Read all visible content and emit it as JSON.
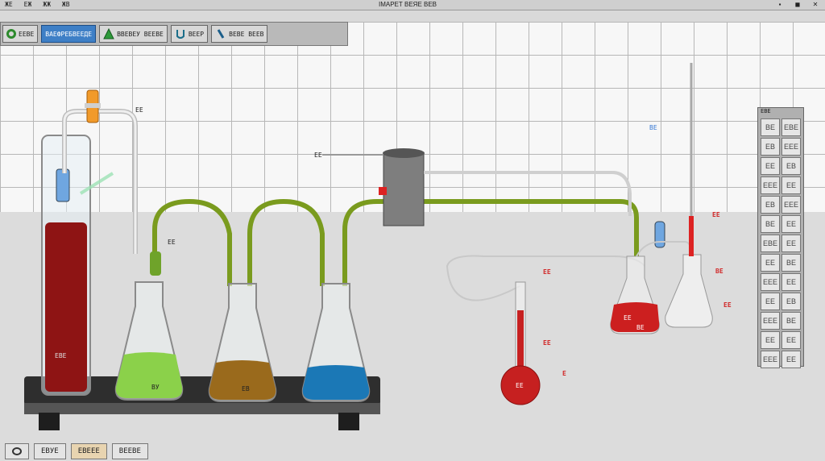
{
  "window": {
    "title": "ІМАРЕТ ВЕЯЕ ВЕВ"
  },
  "menu": [
    "ЖЕ",
    "ЕЖ",
    "ЖЖ",
    "ЖВ"
  ],
  "toolbar": {
    "items": [
      {
        "label": "ЕЕВЕ",
        "icon": "green-ring-icon"
      },
      {
        "label": "ВАЕФРЕБВЕЕДЕ",
        "icon": ""
      },
      {
        "label": "ВВЕВЕУ ВЕЕВЕ",
        "icon": "triangle-flask-icon"
      },
      {
        "label": "ВЕЕР",
        "icon": "u-tube-icon"
      },
      {
        "label": "ВЕВЕ ВЕЕВ",
        "icon": "pipette-icon"
      }
    ]
  },
  "labels": {
    "cylinder": "ЕВЕ",
    "tube_tag": "ЕЕ",
    "clamp": "ЕЕ",
    "flask1": "ВУ",
    "flask2": "ЕВ",
    "vessel_tag": "ЕЕ",
    "blue_tag": "ВЕ",
    "red_right_1": "ЕЕ",
    "red_right_2": "ВЕ",
    "red_right_3": "ЕЕ",
    "tube_red_1": "ЕЕ",
    "tube_red_2": "ЕЕ",
    "tube_red_3": "Е",
    "round_flask": "ЕЕ",
    "erlen_red": "ЕЕ",
    "erlen_red_sub": "ВЕ",
    "erlen_empty": "ЕЕ",
    "pipette": "ЕЕ"
  },
  "palette": {
    "title": "ЕВЕ",
    "items": [
      "ВЕ",
      "ЕВЕ",
      "ЕВ",
      "ЕЕЕ",
      "ЕЕ",
      "ЕВ",
      "ЕЕЕ",
      "ЕЕ",
      "ЕВ",
      "ЕЕЕ",
      "ВЕ",
      "ЕЕ",
      "ЕВЕ",
      "ЕЕ",
      "ЕЕ",
      "ВЕ",
      "ЕЕЕ",
      "ЕЕ",
      "ЕЕ",
      "ЕВ",
      "ЕЕЕ",
      "ВЕ",
      "ЕЕ",
      "ЕЕ",
      "ЕЕЕ",
      "ЕЕ"
    ]
  },
  "status": {
    "items": [
      {
        "label": "",
        "icon": "ring-icon"
      },
      {
        "label": "ЕВУЕ"
      },
      {
        "label": "ЕВЕЕЕ"
      },
      {
        "label": "ВЕЕВЕ"
      }
    ]
  },
  "colors": {
    "red_liquid": "#8e1414",
    "green_liquid": "#8bd14a",
    "brown_liquid": "#9a6a1c",
    "blue_liquid": "#1b78b6",
    "tube_green": "#7a9b1e",
    "stand": "#333333"
  }
}
